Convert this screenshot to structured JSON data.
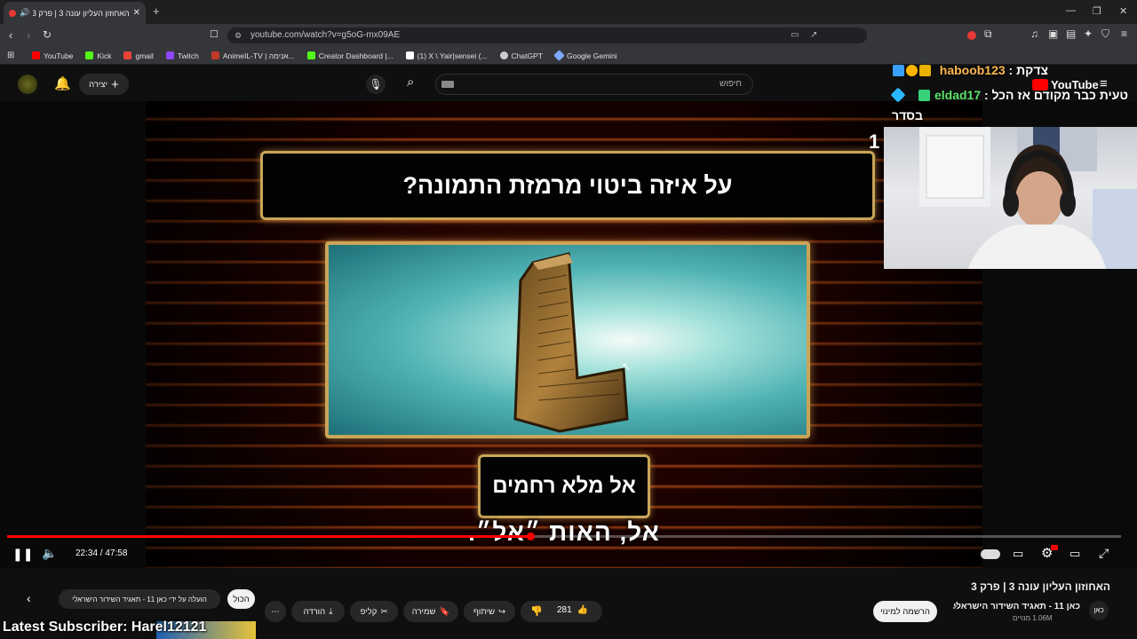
{
  "browser": {
    "tab_title": "האחוזון העליון עונה 3 | פרק 3",
    "url": "youtube.com/watch?v=g5oG-mx09AE",
    "bookmarks": [
      {
        "label": "YouTube",
        "color": "#ff0000"
      },
      {
        "label": "Kick",
        "color": "#53fc18"
      },
      {
        "label": "gmail",
        "color": "#ea4335"
      },
      {
        "label": "Twitch",
        "color": "#9146ff"
      },
      {
        "label": "AnimeIL-TV | אנימה...",
        "color": "#c0392b"
      },
      {
        "label": "Creator Dashboard |...",
        "color": "#53fc18"
      },
      {
        "label": "(1) X \\ Yair|sensei (...",
        "color": "#ffffff"
      },
      {
        "label": "ChatGPT",
        "color": "#cccccc"
      },
      {
        "label": "Google Gemini",
        "color": "#7fa8ff"
      }
    ]
  },
  "youtube": {
    "create_label": "יצירה",
    "search_placeholder": "חיפוש",
    "logo_text": "YouTube"
  },
  "video": {
    "question": "על איזה ביטוי מרמזת התמונה?",
    "answer": "אל מלא רחמים",
    "subtitle": "אל, האות ״אל״.",
    "corner_number": "1",
    "time_current": "22:34",
    "time_total": "47:58",
    "time_display": "22:34 / 47:58",
    "progress_fraction": 0.47
  },
  "chat": [
    {
      "user": "haboob123",
      "message": "צדקת",
      "color": "#ffb84d"
    },
    {
      "user": "eldad17",
      "message": "טעית כבר מקודם אז הכל",
      "color": "#5ee36b"
    },
    {
      "user": "",
      "message": "בסדר",
      "color": "#ffffff"
    }
  ],
  "below": {
    "video_title": "האחוזון העליון עונה 3 | פרק 3",
    "channel_name": "כאן 11 - תאגיד השידור הישראלי",
    "subscribers": "1.06M מנויים",
    "channel_avatar_text": "כאן",
    "subscribe_label": "הרשמה למינוי",
    "likes": "281",
    "share_label": "שיתוף",
    "save_label": "שמירה",
    "clip_label": "קליפ",
    "download_label": "הורדה",
    "chip_all": "הכול",
    "chip_uploaded": "הועלה על ידי כאן 11 - תאגיד השידור הישראלי"
  },
  "overlay": {
    "latest_subscriber": "Latest Subscriber: Harel12121"
  }
}
